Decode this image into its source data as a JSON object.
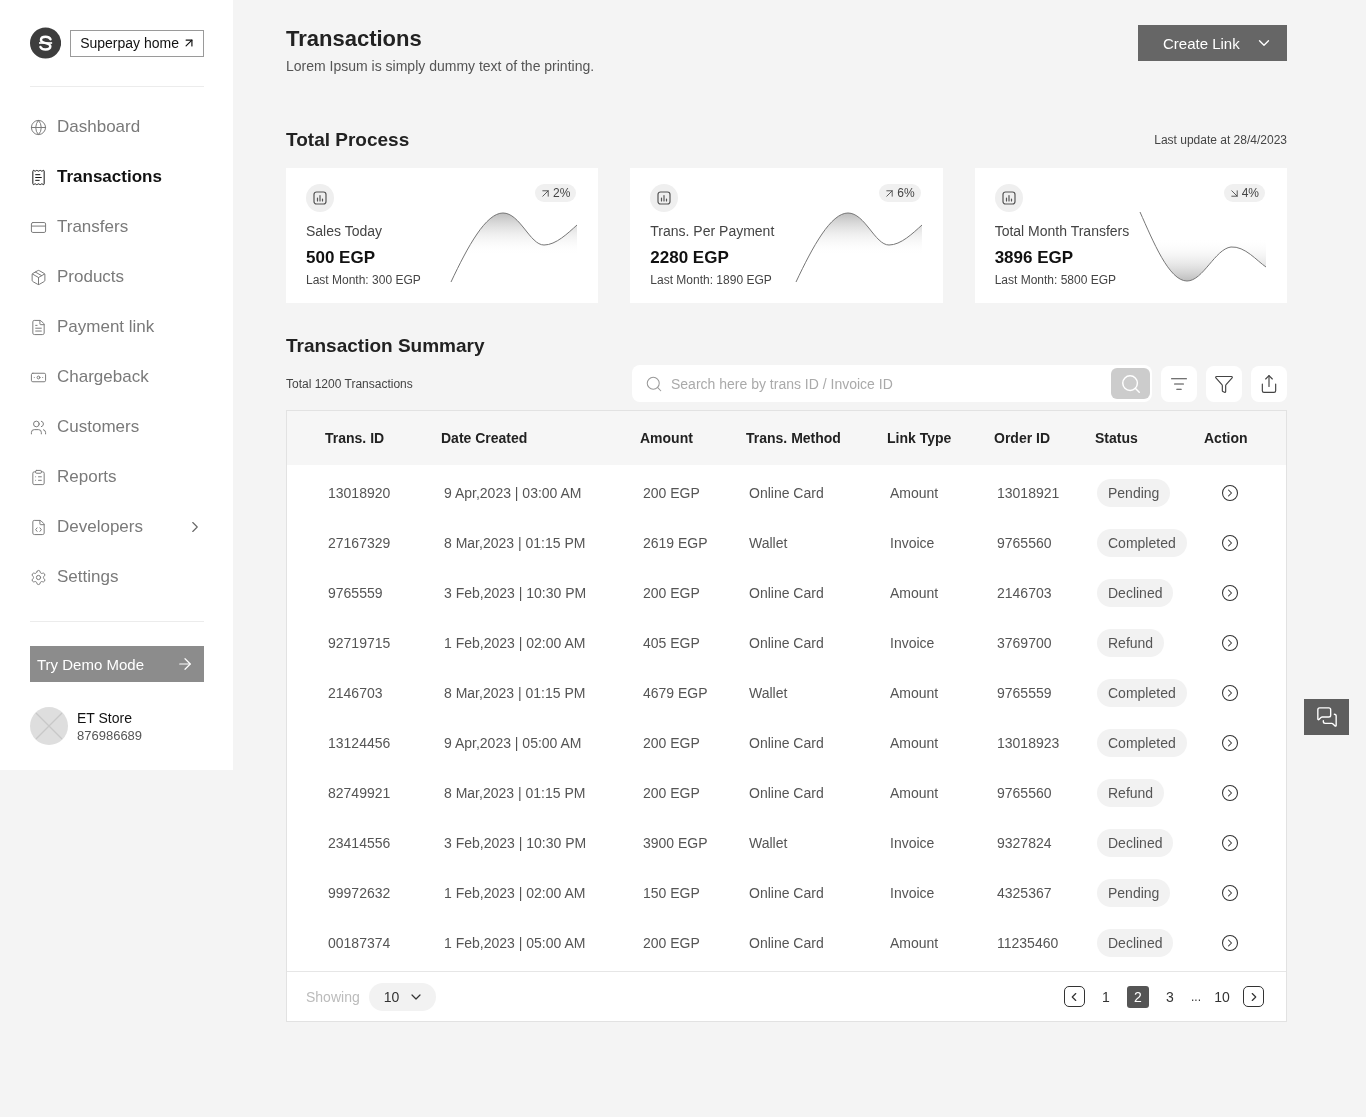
{
  "sidebar": {
    "brand_link": "Superpay home",
    "nav_items": [
      {
        "label": "Dashboard",
        "selected": false,
        "kind": "link"
      },
      {
        "label": "Transactions",
        "selected": true,
        "kind": "link"
      },
      {
        "label": "Transfers",
        "selected": false,
        "kind": "link"
      },
      {
        "label": "Products",
        "selected": false,
        "kind": "link"
      },
      {
        "label": "Payment link",
        "selected": false,
        "kind": "link"
      },
      {
        "label": "Chargeback",
        "selected": false,
        "kind": "link"
      },
      {
        "label": "Customers",
        "selected": false,
        "kind": "link"
      },
      {
        "label": "Reports",
        "selected": false,
        "kind": "link"
      },
      {
        "label": "Developers",
        "selected": false,
        "kind": "submenu"
      },
      {
        "label": "Settings",
        "selected": false,
        "kind": "link"
      }
    ],
    "demo_button": "Try Demo Mode",
    "account": {
      "name": "ET Store",
      "id": "876986689"
    }
  },
  "header": {
    "title": "Transactions",
    "subtitle": "Lorem Ipsum is simply dummy text of the printing.",
    "create_button": "Create Link"
  },
  "total_process": {
    "title": "Total Process",
    "last_update": "Last update at 28/4/2023",
    "cards": [
      {
        "label": "Sales Today",
        "value": "500 EGP",
        "last_month": "Last Month: 300 EGP",
        "change": "2%",
        "kind": "up"
      },
      {
        "label": "Trans. Per Payment",
        "value": "2280 EGP",
        "last_month": "Last Month: 1890 EGP",
        "change": "6%",
        "kind": "up"
      },
      {
        "label": "Total Month Transfers",
        "value": "3896 EGP",
        "last_month": "Last Month: 5800 EGP",
        "change": "4%",
        "kind": "down"
      }
    ]
  },
  "summary": {
    "title": "Transaction Summary",
    "total": "Total 1200 Transactions",
    "search": {
      "placeholder": "Search here by trans ID / Invoice ID"
    },
    "table": {
      "columns": [
        "Trans. ID",
        "Date Created",
        "Amount",
        "Trans. Method",
        "Link Type",
        "Order ID",
        "Status",
        "Action"
      ],
      "rows": [
        {
          "trans_id": "13018920",
          "date_created": "9 Apr,2023 | 03:00 AM",
          "amount": "200 EGP",
          "method": "Online Card",
          "link_type": "Amount",
          "order_id": "13018921",
          "status": "Pending"
        },
        {
          "trans_id": "27167329",
          "date_created": "8 Mar,2023 | 01:15 PM",
          "amount": "2619 EGP",
          "method": "Wallet",
          "link_type": "Invoice",
          "order_id": "9765560",
          "status": "Completed"
        },
        {
          "trans_id": "9765559",
          "date_created": "3 Feb,2023 | 10:30 PM",
          "amount": "200 EGP",
          "method": "Online Card",
          "link_type": "Amount",
          "order_id": "2146703",
          "status": "Declined"
        },
        {
          "trans_id": "92719715",
          "date_created": "1 Feb,2023 | 02:00 AM",
          "amount": "405 EGP",
          "method": "Online Card",
          "link_type": "Invoice",
          "order_id": "3769700",
          "status": "Refund"
        },
        {
          "trans_id": "2146703",
          "date_created": "8 Mar,2023 | 01:15 PM",
          "amount": "4679 EGP",
          "method": "Wallet",
          "link_type": "Amount",
          "order_id": "9765559",
          "status": "Completed"
        },
        {
          "trans_id": "13124456",
          "date_created": "9 Apr,2023 | 05:00 AM",
          "amount": "200 EGP",
          "method": "Online Card",
          "link_type": "Amount",
          "order_id": "13018923",
          "status": "Completed"
        },
        {
          "trans_id": "82749921",
          "date_created": "8 Mar,2023 | 01:15 PM",
          "amount": "200 EGP",
          "method": "Online Card",
          "link_type": "Amount",
          "order_id": "9765560",
          "status": "Refund"
        },
        {
          "trans_id": "23414556",
          "date_created": "3 Feb,2023 | 10:30 PM",
          "amount": "3900 EGP",
          "method": "Wallet",
          "link_type": "Invoice",
          "order_id": "9327824",
          "status": "Declined"
        },
        {
          "trans_id": "99972632",
          "date_created": "1 Feb,2023 | 02:00 AM",
          "amount": "150 EGP",
          "method": "Online Card",
          "link_type": "Invoice",
          "order_id": "4325367",
          "status": "Pending"
        },
        {
          "trans_id": "00187374",
          "date_created": "1 Feb,2023 | 05:00 AM",
          "amount": "200 EGP",
          "method": "Online Card",
          "link_type": "Amount",
          "order_id": "11235460",
          "status": "Declined"
        }
      ]
    },
    "footer": {
      "showing_label": "Showing",
      "page_size": "10",
      "pages": [
        {
          "label": "1",
          "selected": false
        },
        {
          "label": "2",
          "selected": true
        },
        {
          "label": "3",
          "selected": false
        },
        {
          "label": "10",
          "selected": false
        }
      ],
      "ellipsis": "..."
    }
  }
}
